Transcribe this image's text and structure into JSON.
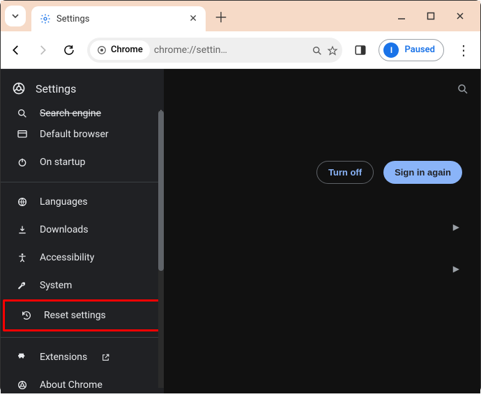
{
  "window": {
    "tab_title": "Settings",
    "min": "minimize",
    "max": "maximize",
    "close": "close"
  },
  "toolbar": {
    "chrome_label": "Chrome",
    "url": "chrome://settin…",
    "paused_label": "Paused",
    "avatar_initial": "I"
  },
  "settings": {
    "header": "Settings",
    "sidebar": {
      "cut_item": "Search engine",
      "items_top": [
        {
          "icon": "browser",
          "label": "Default browser"
        },
        {
          "icon": "power",
          "label": "On startup"
        }
      ],
      "items_mid": [
        {
          "icon": "globe",
          "label": "Languages"
        },
        {
          "icon": "download",
          "label": "Downloads"
        },
        {
          "icon": "accessibility",
          "label": "Accessibility"
        },
        {
          "icon": "wrench",
          "label": "System"
        }
      ],
      "reset": {
        "icon": "history",
        "label": "Reset settings"
      },
      "items_bot": [
        {
          "icon": "puzzle",
          "label": "Extensions",
          "launch": true
        },
        {
          "icon": "chrome",
          "label": "About Chrome"
        }
      ]
    },
    "actions": {
      "turn_off": "Turn off",
      "sign_in": "Sign in again"
    }
  }
}
